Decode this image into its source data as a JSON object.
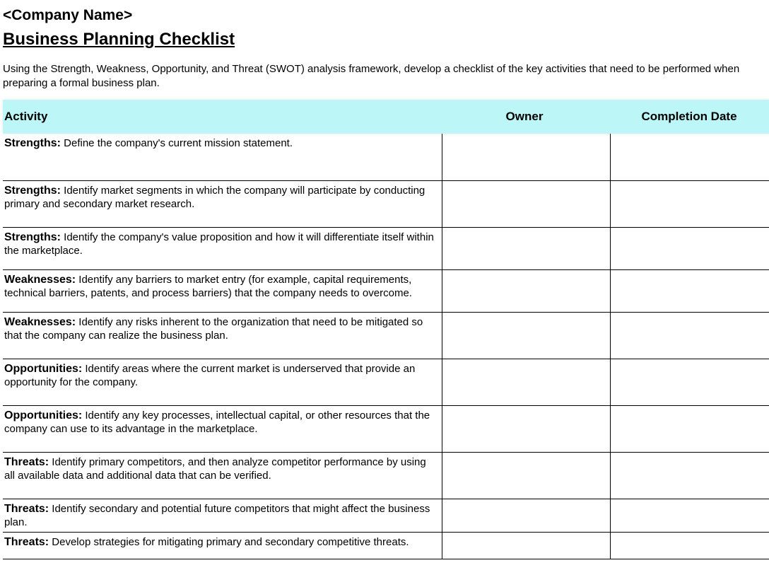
{
  "company_name": "<Company Name>",
  "title": "Business Planning Checklist",
  "intro": "Using the Strength, Weakness, Opportunity, and Threat (SWOT) analysis framework, develop a checklist of the key activities that need to be performed when preparing a formal business plan.",
  "table": {
    "headers": {
      "activity": "Activity",
      "owner": "Owner",
      "completion_date": "Completion Date"
    },
    "rows": [
      {
        "category": "Strengths:",
        "text": " Define the company's current mission statement.",
        "owner": "",
        "completion_date": "",
        "size": "row-h"
      },
      {
        "category": "Strengths:",
        "text": " Identify market segments in which the company will participate by conducting primary and secondary market research.",
        "owner": "",
        "completion_date": "",
        "size": "row-h"
      },
      {
        "category": "Strengths:",
        "text": " Identify the company's value proposition and how it will differentiate itself within the marketplace.",
        "owner": "",
        "completion_date": "",
        "size": "row-m"
      },
      {
        "category": "Weaknesses:",
        "text": " Identify any barriers to market entry (for example, capital requirements, technical barriers, patents, and process barriers) that the company needs to overcome.",
        "owner": "",
        "completion_date": "",
        "size": "row-m"
      },
      {
        "category": "Weaknesses:",
        "text": " Identify any risks inherent to the organization that need to be mitigated so that the company can realize the business plan.",
        "owner": "",
        "completion_date": "",
        "size": "row-h"
      },
      {
        "category": "Opportunities:",
        "text": " Identify areas where the current market is underserved that provide an opportunity for the company.",
        "owner": "",
        "completion_date": "",
        "size": "row-h"
      },
      {
        "category": "Opportunities:",
        "text": " Identify any key processes, intellectual capital, or other resources that the company can use to its advantage in the marketplace.",
        "owner": "",
        "completion_date": "",
        "size": "row-h"
      },
      {
        "category": "Threats:",
        "text": " Identify primary competitors, and then analyze competitor performance by using all available data and additional data that can be verified.",
        "owner": "",
        "completion_date": "",
        "size": "row-h"
      },
      {
        "category": "Threats:",
        "text": " Identify secondary and potential future competitors that might affect the business plan.",
        "owner": "",
        "completion_date": "",
        "size": "row-s"
      },
      {
        "category": "Threats:",
        "text": " Develop strategies for mitigating primary and secondary competitive threats.",
        "owner": "",
        "completion_date": "",
        "size": "row-s"
      }
    ]
  }
}
